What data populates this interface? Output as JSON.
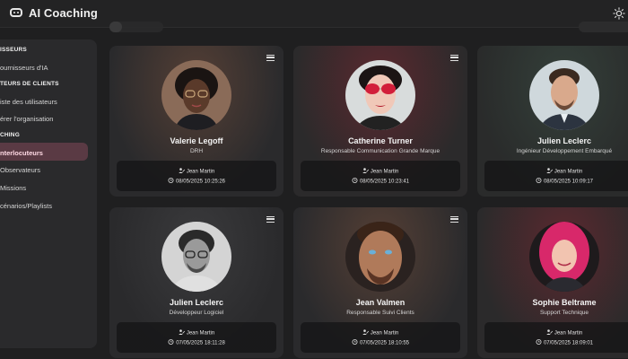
{
  "app": {
    "title": "AI Coaching"
  },
  "sidebar": {
    "sections": [
      {
        "label": "ISSEURS",
        "items": [
          "ournisseurs d'IA"
        ]
      },
      {
        "label": "TEURS DE CLIENTS",
        "items": [
          "iste des utilisateurs",
          "érer l'organisation"
        ]
      },
      {
        "label": "CHING",
        "items": [
          "nterlocuteurs",
          "Observateurs",
          "Missions",
          "cénarios/Playlists"
        ]
      }
    ],
    "active_item": "nterlocuteurs"
  },
  "cards": [
    {
      "name": "Valerie Legoff",
      "role": "DRH",
      "author": "Jean Martin",
      "date": "08/05/2025 10:25:26",
      "avatar": "avatar-woman-glasses"
    },
    {
      "name": "Catherine Turner",
      "role": "Responsable Communication Grande Marque",
      "author": "Jean Martin",
      "date": "08/05/2025 10:23:41",
      "avatar": "avatar-woman-red-sunglasses"
    },
    {
      "name": "Julien Leclerc",
      "role": "Ingénieur Développement Embarqué",
      "author": "Jean Martin",
      "date": "08/05/2025 10:09:17",
      "avatar": "avatar-man-suit"
    },
    {
      "name": "Julien Leclerc",
      "role": "Développeur Logiciel",
      "author": "Jean Martin",
      "date": "07/05/2025 18:11:28",
      "avatar": "avatar-man-glasses-bw"
    },
    {
      "name": "Jean Valmen",
      "role": "Responsable Suivi Clients",
      "author": "Jean Martin",
      "date": "07/05/2025 18:10:55",
      "avatar": "avatar-man-portrait"
    },
    {
      "name": "Sophie Beltrame",
      "role": "Support Technique",
      "author": "Jean Martin",
      "date": "07/05/2025 18:09:01",
      "avatar": "avatar-woman-pink-hair"
    }
  ],
  "colors": {
    "background": "#1f1f20",
    "sidebar": "#2a2a2c",
    "active_item": "#5a3a44",
    "card": "#2b2b2d"
  }
}
